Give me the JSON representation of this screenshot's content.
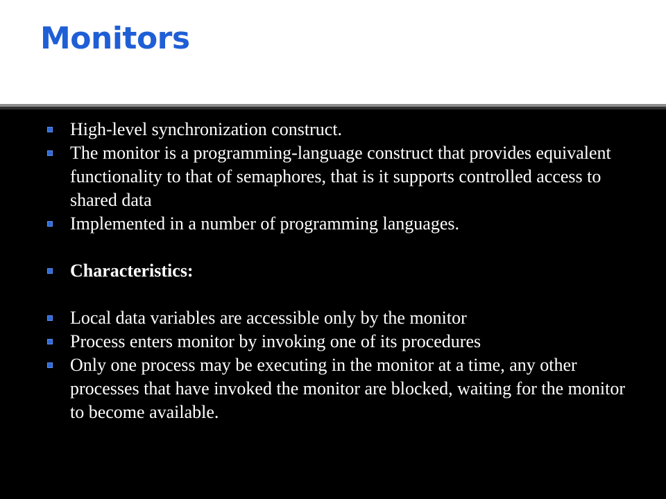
{
  "slide": {
    "title": "Monitors",
    "colors": {
      "title": "#1f5fd6",
      "bullet_marker": "#2f6ad8",
      "body_text": "#ffffff",
      "background": "#000000",
      "title_band": "#ffffff"
    },
    "bullet_icon": "square-bullet-icon",
    "bullets": [
      {
        "text": "High-level synchronization construct."
      },
      {
        "text": "The monitor is a programming-language construct that provides equivalent functionality to that of semaphores, that is it supports controlled access to shared data"
      },
      {
        "text": "Implemented in a number of programming languages."
      },
      {
        "text": "Characteristics:"
      },
      {
        "text": "Local data variables are accessible only by the monitor"
      },
      {
        "text": "Process enters monitor by invoking one of its procedures"
      },
      {
        "text": "Only one process may be executing in the monitor at a time, any other processes that have invoked the monitor are blocked, waiting for the monitor to become available."
      }
    ]
  }
}
